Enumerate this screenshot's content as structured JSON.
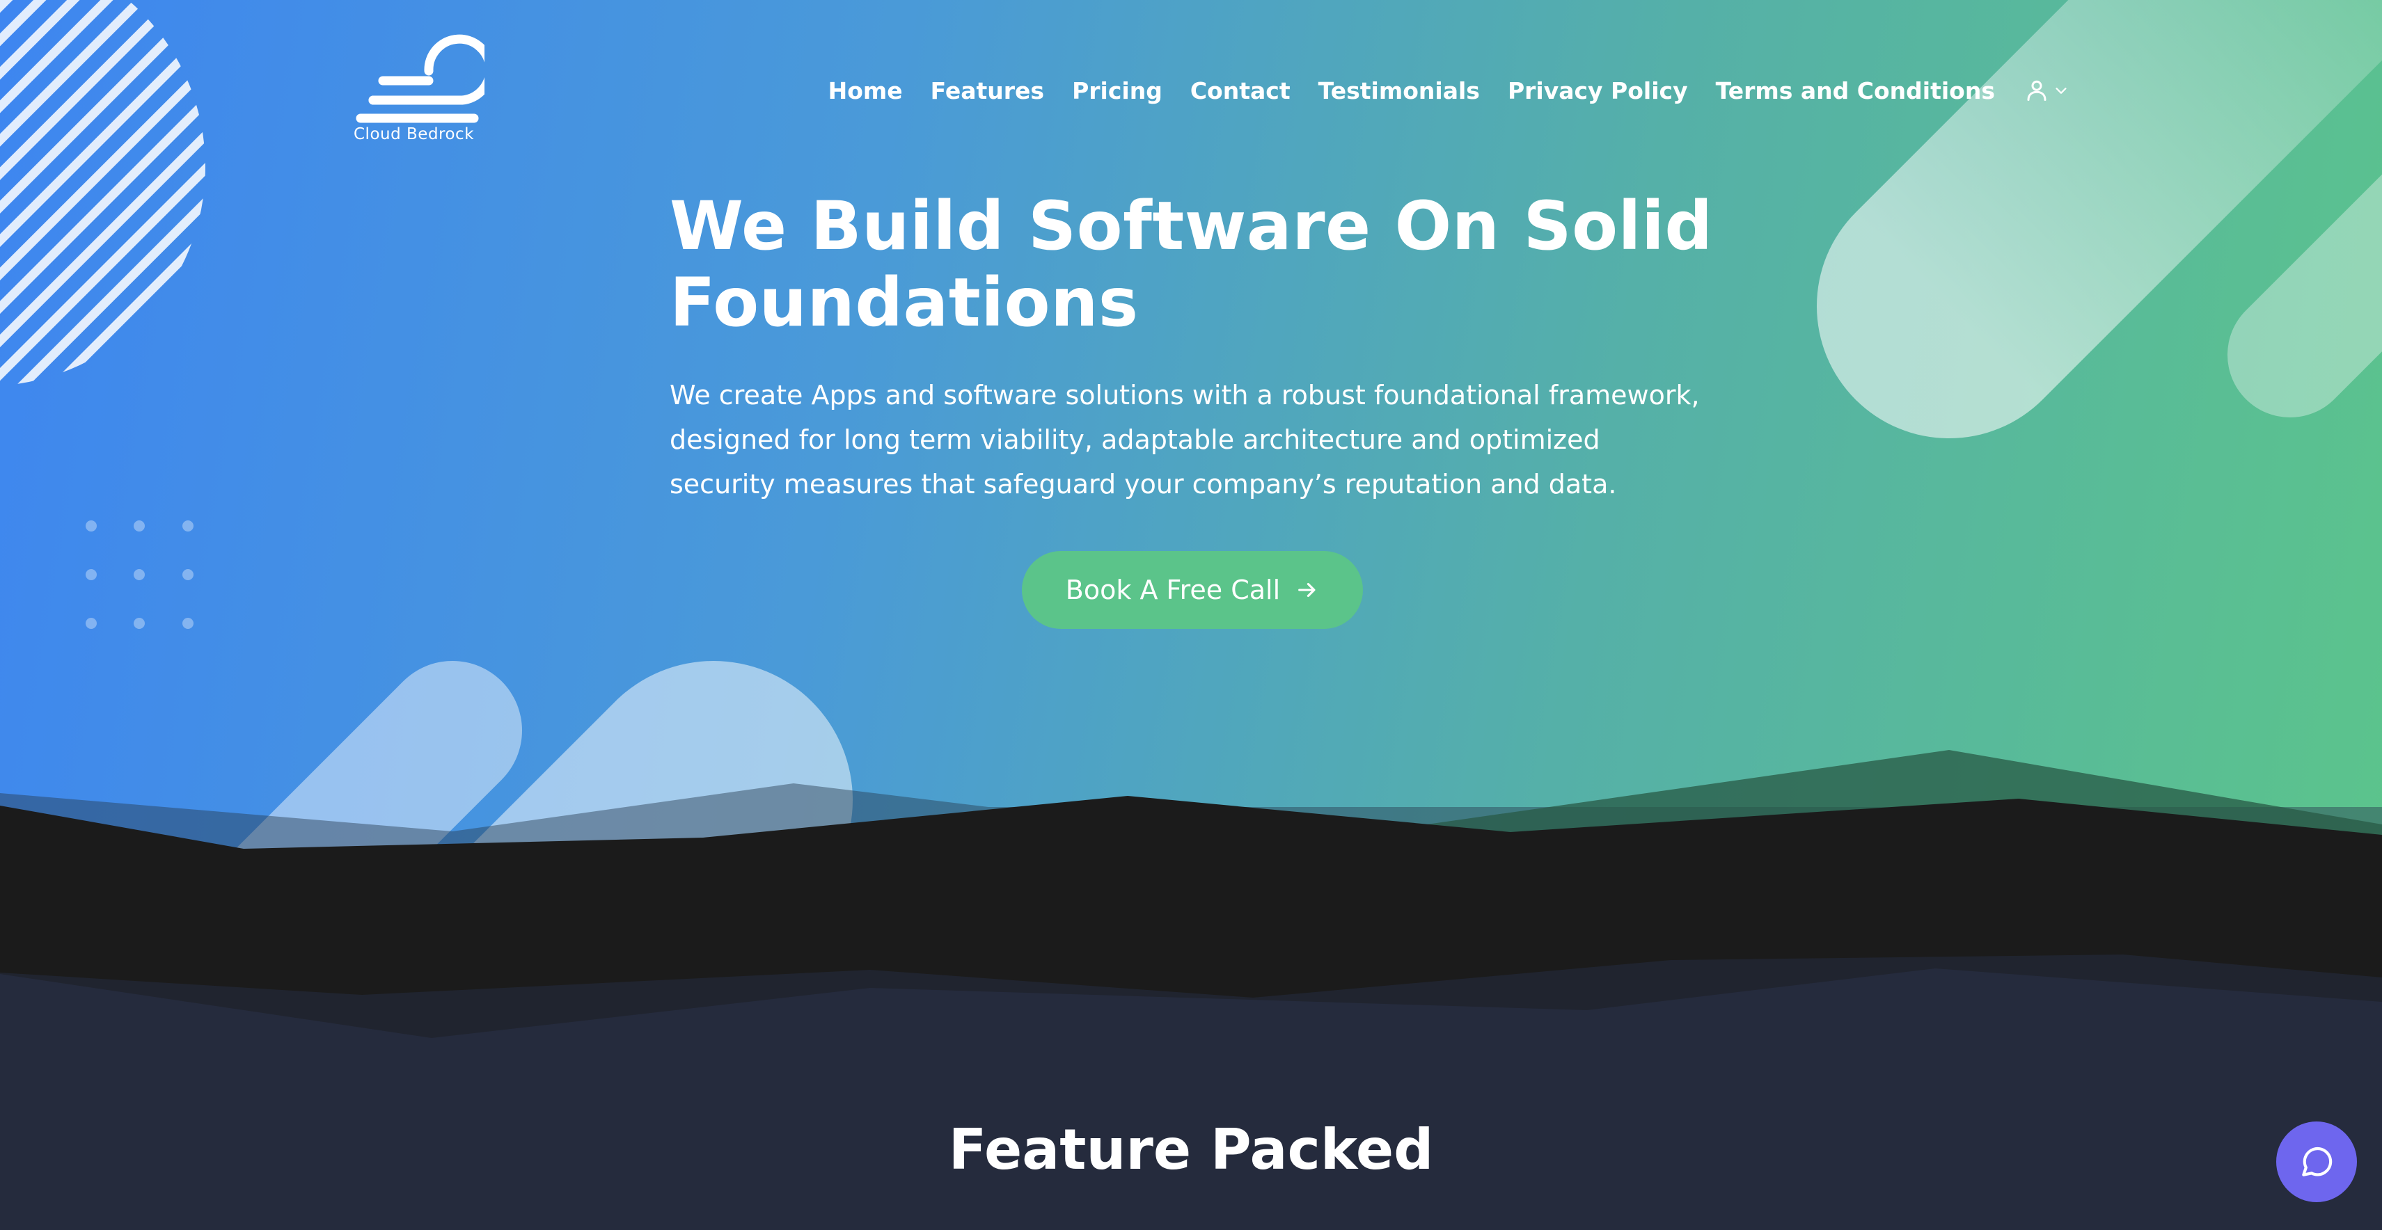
{
  "brand": {
    "name": "Cloud Bedrock"
  },
  "nav": {
    "items": [
      {
        "label": "Home"
      },
      {
        "label": "Features"
      },
      {
        "label": "Pricing"
      },
      {
        "label": "Contact"
      },
      {
        "label": "Testimonials"
      },
      {
        "label": "Privacy Policy"
      },
      {
        "label": "Terms and Conditions"
      }
    ],
    "account_icon": "user-icon",
    "account_dropdown_icon": "chevron-down-icon"
  },
  "hero": {
    "title": "We Build Software On Solid Foundations",
    "description": "We create Apps and software solutions with a robust foundational framework, designed for long term viability, adaptable architecture and optimized security measures that safeguard your company’s reputation and data.",
    "cta_label": "Book A Free Call",
    "cta_icon": "arrow-right-icon"
  },
  "features": {
    "title": "Feature Packed"
  },
  "chat": {
    "icon": "chat-icon"
  },
  "colors": {
    "gradient_start": "#3e86f0",
    "gradient_end": "#5cc58a",
    "cta": "#5bc48a",
    "mountain_dark": "#1b1b1b",
    "section_bg": "#252b3d",
    "chat_button": "#6e66ee"
  }
}
